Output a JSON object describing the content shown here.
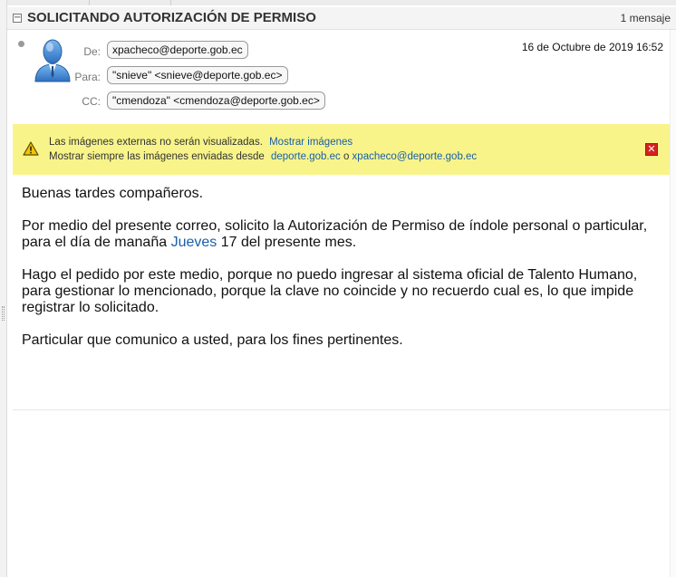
{
  "thread": {
    "title": "SOLICITANDO AUTORIZACIÓN DE PERMISO",
    "count": "1 mensaje",
    "collapse_glyph": "⊟"
  },
  "message": {
    "from_label": "De:",
    "from": "xpacheco@deporte.gob.ec",
    "to_label": "Para:",
    "to": "\"snieve\" <snieve@deporte.gob.ec>",
    "cc_label": "CC:",
    "cc": "\"cmendoza\" <cmendoza@deporte.gob.ec>",
    "date": "16 de Octubre de 2019 16:52",
    "avatar_icon": "user-avatar-icon"
  },
  "warning": {
    "icon": "warning-triangle-icon",
    "line1_text": "Las imágenes externas no serán visualizadas.",
    "show_images_link": "Mostrar imágenes",
    "line2_text": "Mostrar siempre las imágenes enviadas desde",
    "domain_link": "deporte.gob.ec",
    "or_text": "o",
    "sender_link": "xpacheco@deporte.gob.ec",
    "close_glyph": "✕"
  },
  "body": {
    "greeting": "Buenas tardes compañeros.",
    "p2_before": "Por medio del presente correo, solicito la Autorización de Permiso de índole personal o particular, para el día de manaña",
    "p2_link": "Jueves",
    "p2_after": "17 del presente mes.",
    "p3": "Hago el pedido por este medio, porque no puedo ingresar al sistema oficial de Talento Humano, para gestionar lo mencionado, porque la clave no coincide y no recuerdo cual es, lo que impide registrar lo solicitado.",
    "p4": "Particular que comunico a usted, para los fines pertinentes."
  },
  "colors": {
    "warning_bg": "#f8f48a",
    "link": "#1a5fa8",
    "close_red": "#d32222",
    "avatar_blue": "#4a8fd6"
  }
}
